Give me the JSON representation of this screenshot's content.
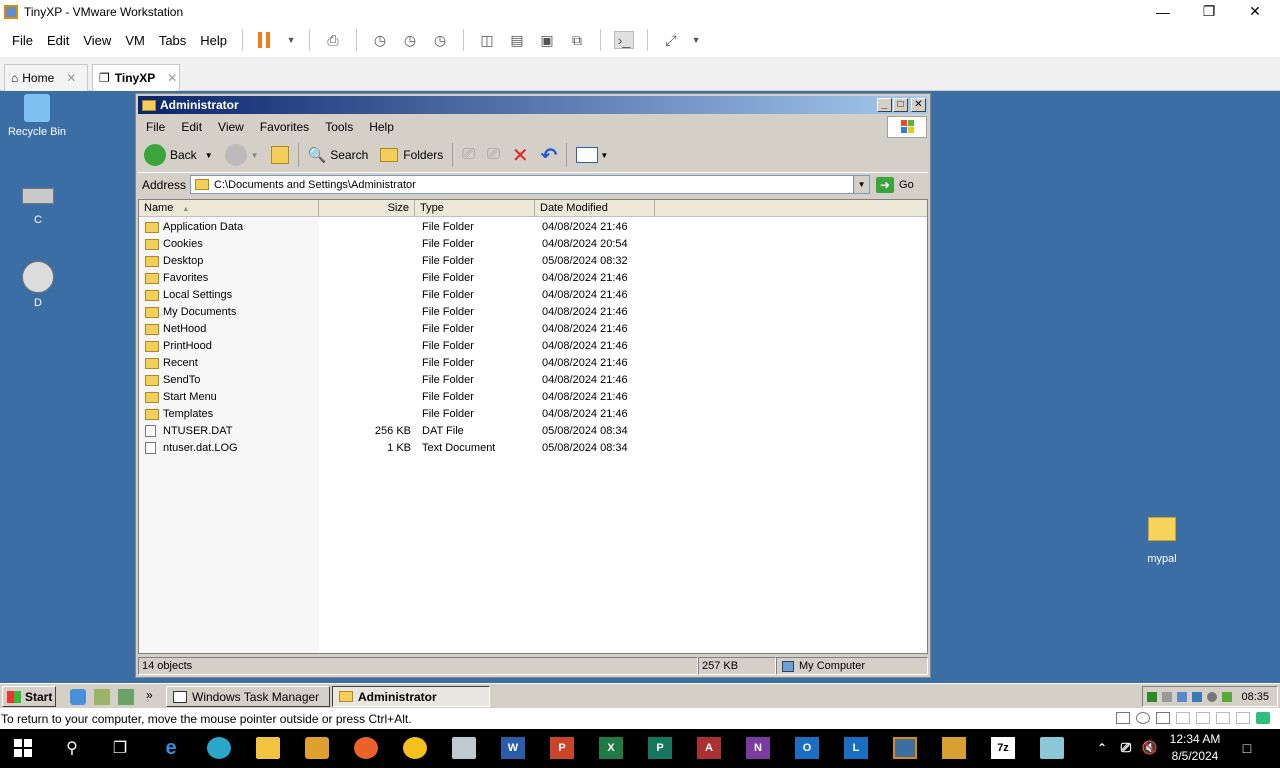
{
  "host": {
    "title": "TinyXP - VMware Workstation",
    "menu": [
      "File",
      "Edit",
      "View",
      "VM",
      "Tabs",
      "Help"
    ],
    "tabs": [
      {
        "label": "Home"
      },
      {
        "label": "TinyXP"
      }
    ],
    "hint": "To return to your computer, move the mouse pointer outside or press Ctrl+Alt."
  },
  "desktop": {
    "icons": [
      {
        "label": "Recycle Bin"
      },
      {
        "label": "C"
      },
      {
        "label": "D"
      },
      {
        "label": "mypal"
      }
    ]
  },
  "explorer": {
    "title": "Administrator",
    "menu": [
      "File",
      "Edit",
      "View",
      "Favorites",
      "Tools",
      "Help"
    ],
    "toolbar": {
      "back": "Back",
      "search": "Search",
      "folders": "Folders"
    },
    "address_label": "Address",
    "address": "C:\\Documents and Settings\\Administrator",
    "go": "Go",
    "columns": [
      "Name",
      "Size",
      "Type",
      "Date Modified"
    ],
    "files": [
      {
        "name": "Application Data",
        "size": "",
        "type": "File Folder",
        "date": "04/08/2024 21:46",
        "kind": "folder"
      },
      {
        "name": "Cookies",
        "size": "",
        "type": "File Folder",
        "date": "04/08/2024 20:54",
        "kind": "folder"
      },
      {
        "name": "Desktop",
        "size": "",
        "type": "File Folder",
        "date": "05/08/2024 08:32",
        "kind": "folder"
      },
      {
        "name": "Favorites",
        "size": "",
        "type": "File Folder",
        "date": "04/08/2024 21:46",
        "kind": "folder"
      },
      {
        "name": "Local Settings",
        "size": "",
        "type": "File Folder",
        "date": "04/08/2024 21:46",
        "kind": "folder"
      },
      {
        "name": "My Documents",
        "size": "",
        "type": "File Folder",
        "date": "04/08/2024 21:46",
        "kind": "folder"
      },
      {
        "name": "NetHood",
        "size": "",
        "type": "File Folder",
        "date": "04/08/2024 21:46",
        "kind": "folder"
      },
      {
        "name": "PrintHood",
        "size": "",
        "type": "File Folder",
        "date": "04/08/2024 21:46",
        "kind": "folder"
      },
      {
        "name": "Recent",
        "size": "",
        "type": "File Folder",
        "date": "04/08/2024 21:46",
        "kind": "folder"
      },
      {
        "name": "SendTo",
        "size": "",
        "type": "File Folder",
        "date": "04/08/2024 21:46",
        "kind": "folder"
      },
      {
        "name": "Start Menu",
        "size": "",
        "type": "File Folder",
        "date": "04/08/2024 21:46",
        "kind": "folder"
      },
      {
        "name": "Templates",
        "size": "",
        "type": "File Folder",
        "date": "04/08/2024 21:46",
        "kind": "folder"
      },
      {
        "name": "NTUSER.DAT",
        "size": "256 KB",
        "type": "DAT File",
        "date": "05/08/2024 08:34",
        "kind": "file"
      },
      {
        "name": "ntuser.dat.LOG",
        "size": "1 KB",
        "type": "Text Document",
        "date": "05/08/2024 08:34",
        "kind": "file"
      }
    ],
    "status": {
      "objects": "14 objects",
      "size": "257 KB",
      "zone": "My Computer"
    }
  },
  "xp_taskbar": {
    "start": "Start",
    "tasks": [
      "Windows Task Manager",
      "Administrator"
    ],
    "clock": "08:35"
  },
  "win10": {
    "time": "12:34 AM",
    "date": "8/5/2024"
  },
  "colors": {
    "desktop": "#3a6ea5",
    "xp_title_start": "#0a246a",
    "xp_title_end": "#a6caf0",
    "pause": "#ef7d1a"
  }
}
